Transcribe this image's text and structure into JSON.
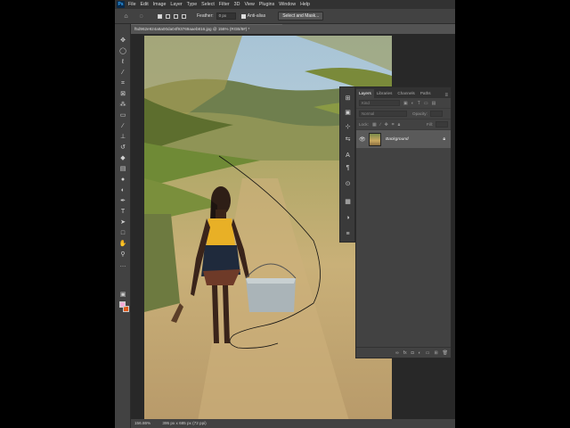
{
  "app": {
    "name": "Photoshop",
    "logo_text": "Ps",
    "menu": [
      "File",
      "Edit",
      "Image",
      "Layer",
      "Type",
      "Select",
      "Filter",
      "3D",
      "View",
      "Plugins",
      "Window",
      "Help"
    ]
  },
  "options_bar": {
    "feather_label": "Feather:",
    "feather_value": "0 px",
    "antialias_label": "Anti-alias",
    "select_mask_label": "Select and Mask..."
  },
  "document": {
    "tab_title": "f5d962e924a8a00da04f93769aaeb816.jpg @ 156% (RGB/8#) *",
    "zoom": "156.86%",
    "dimensions": "395 px x 685 px (72 ppi)"
  },
  "colors": {
    "foreground": "#f7a8d7",
    "background": "#e05a1a"
  },
  "tools": [
    "home-icon",
    "lasso-icon",
    "move-icon",
    "marquee-icon",
    "lasso-tool-icon",
    "object-select-icon",
    "crop-icon",
    "frame-icon",
    "eyedropper-icon",
    "spot-heal-icon",
    "brush-icon",
    "stamp-icon",
    "history-brush-icon",
    "eraser-icon",
    "gradient-icon",
    "blur-icon",
    "dodge-icon",
    "pen-icon",
    "type-icon",
    "path-select-icon",
    "rectangle-icon",
    "hand-icon",
    "zoom-icon",
    "more-icon",
    "quick-mask-icon",
    "screen-mode-icon"
  ],
  "layers_panel": {
    "tabs": [
      "Layers",
      "Libraries",
      "Channels",
      "Paths"
    ],
    "active_tab": "Layers",
    "kind_placeholder": "Kind",
    "blend_mode": "Normal",
    "opacity_label": "Opacity:",
    "lock_label": "Lock:",
    "fill_label": "Fill:",
    "layers": [
      {
        "name": "Background",
        "visible": true,
        "locked": true
      }
    ]
  }
}
